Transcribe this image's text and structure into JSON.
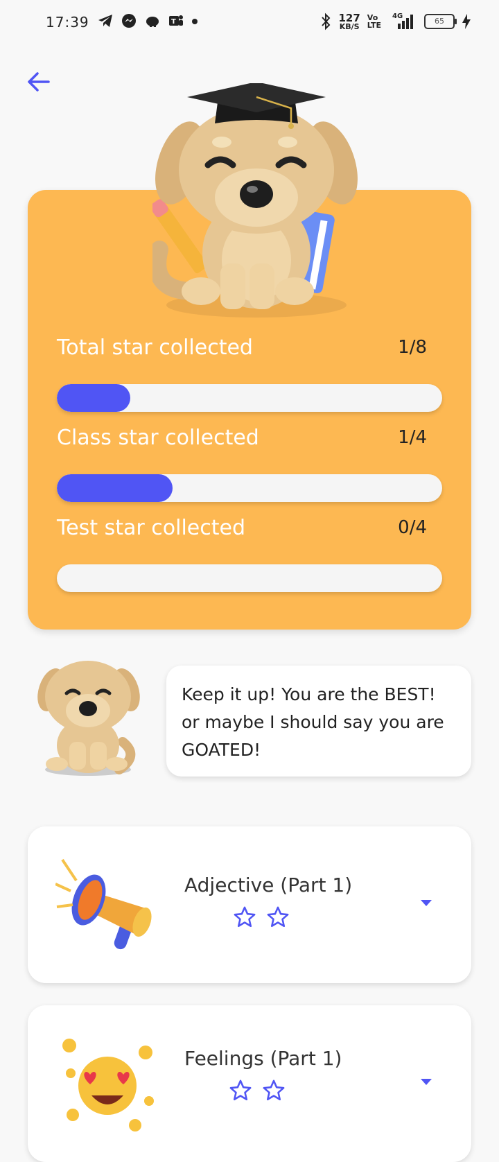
{
  "status_bar": {
    "time": "17:39",
    "speed_value": "127",
    "speed_unit": "KB/S",
    "volte_top": "Vo",
    "volte_bottom": "LTE",
    "network": "4G",
    "battery": "65"
  },
  "stats": [
    {
      "label": "Total star collected",
      "count": "1/8",
      "progress": 0.19
    },
    {
      "label": "Class star collected",
      "count": "1/4",
      "progress": 0.3
    },
    {
      "label": "Test star collected",
      "count": "0/4",
      "progress": 0.0
    }
  ],
  "message": "Keep it up! You are the BEST! or maybe I should say you are GOATED!",
  "lessons": [
    {
      "title": "Adjective (Part 1)",
      "stars": 2,
      "icon": "megaphone-icon"
    },
    {
      "title": "Feelings (Part 1)",
      "stars": 2,
      "icon": "heart-eyes-emoji-icon"
    }
  ],
  "colors": {
    "accent": "#5055f4",
    "card": "#fdb852",
    "background": "#f8f8f8"
  }
}
